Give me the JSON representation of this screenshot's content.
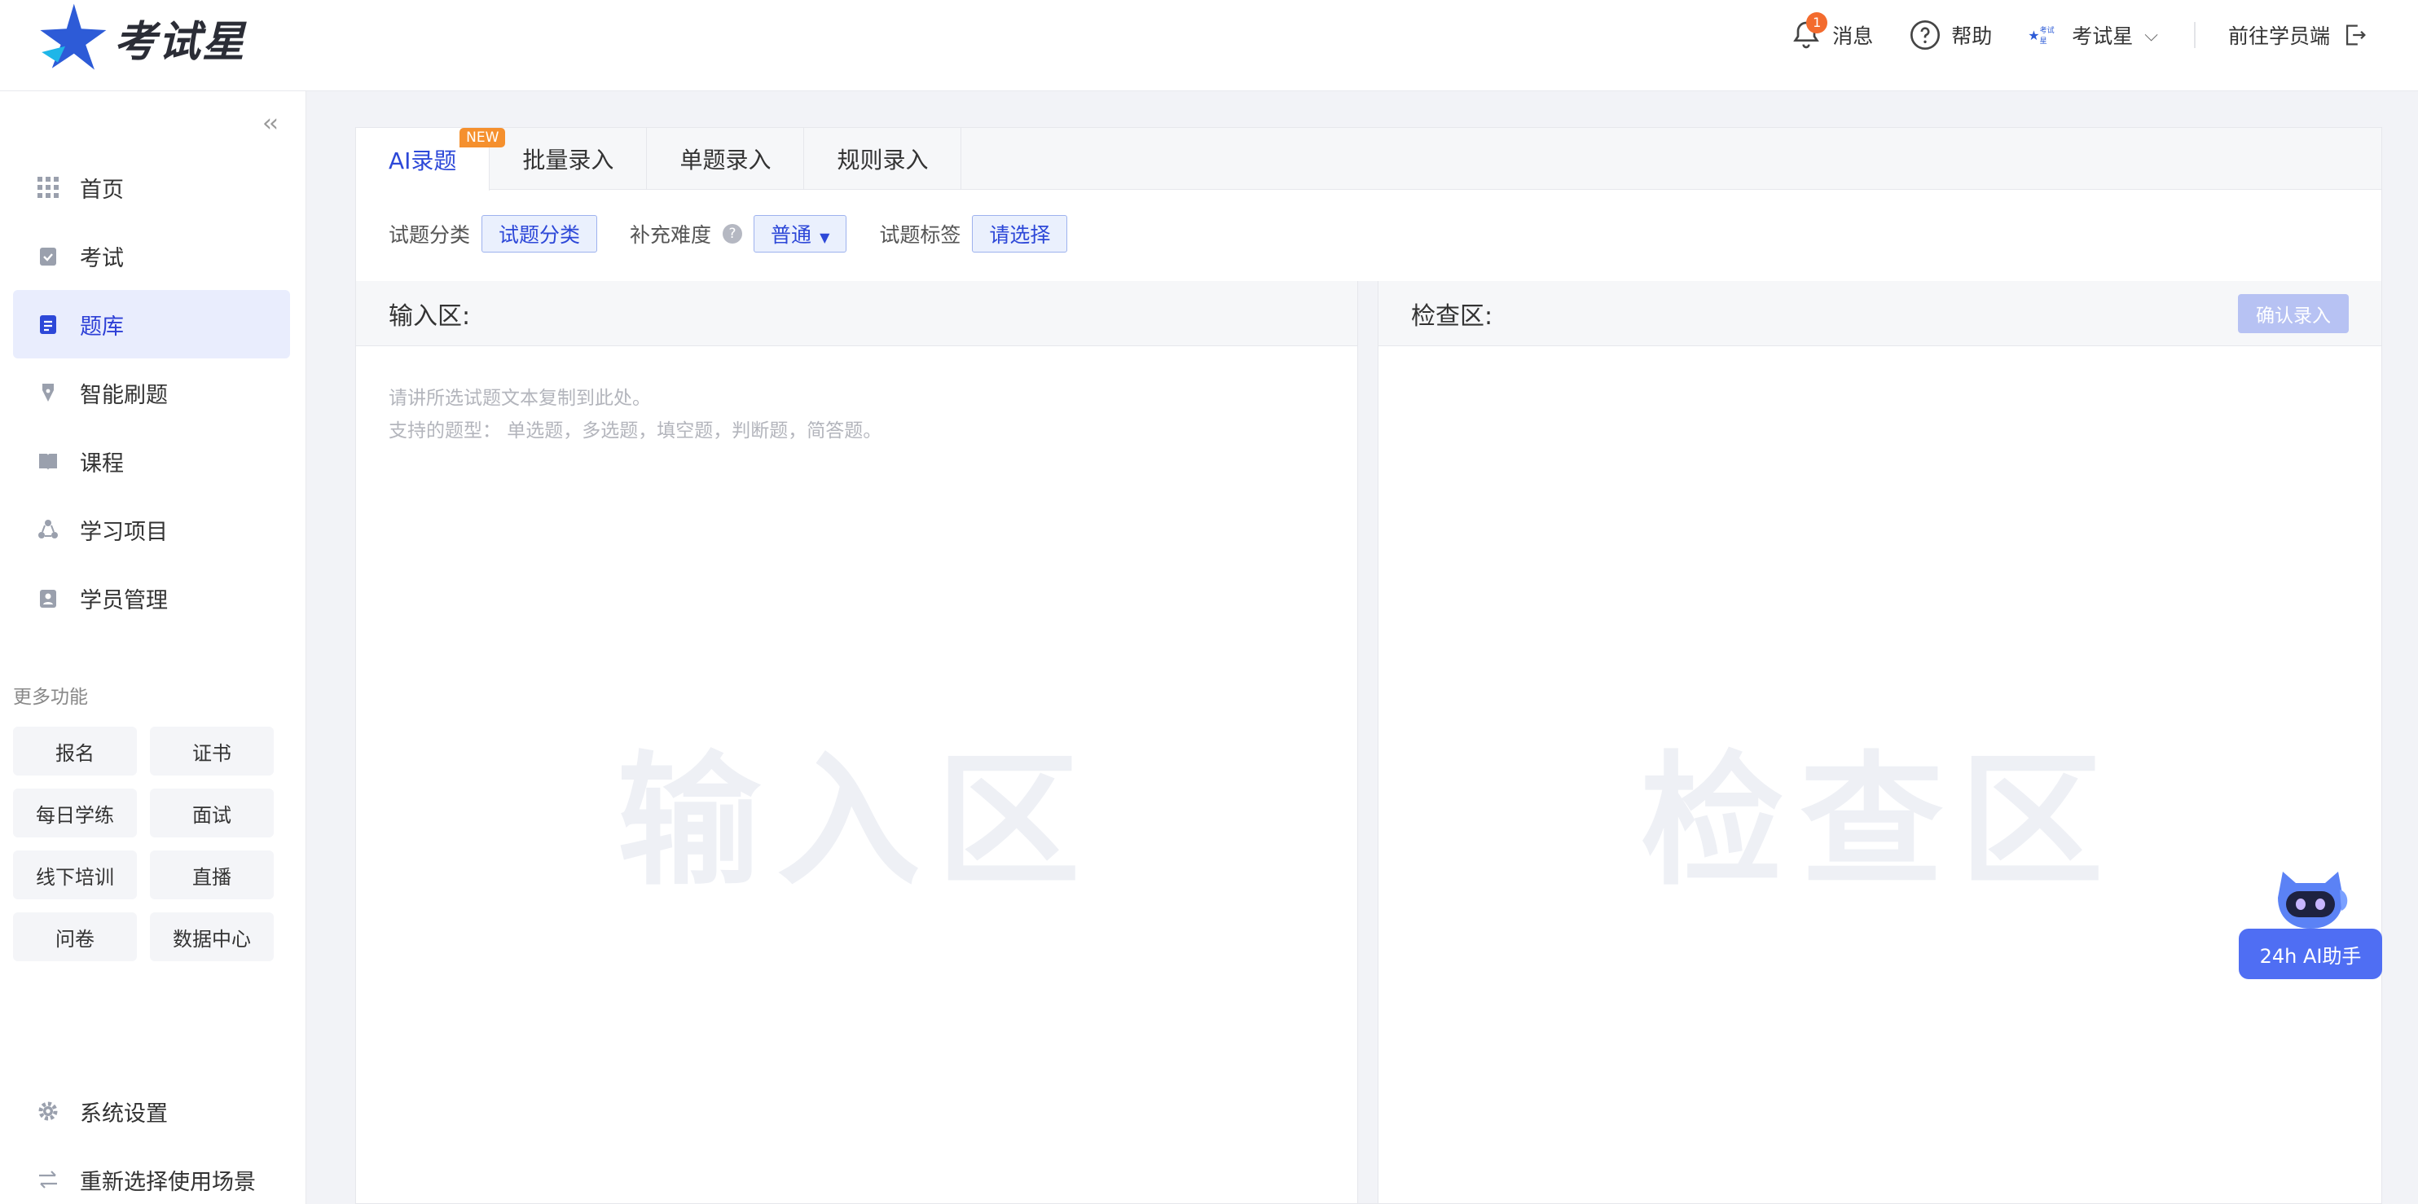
{
  "app": {
    "logo_text": "考试星",
    "brand_color": "#2d48d8"
  },
  "topbar": {
    "messages_label": "消息",
    "messages_count": "1",
    "help_label": "帮助",
    "org_name": "考试星",
    "org_logo_text": "考试星",
    "student_portal_label": "前往学员端"
  },
  "sidebar": {
    "items": [
      {
        "label": "首页",
        "icon": "grid-icon"
      },
      {
        "label": "考试",
        "icon": "clipboard-check-icon"
      },
      {
        "label": "题库",
        "icon": "document-list-icon",
        "active": true
      },
      {
        "label": "智能刷题",
        "icon": "pen-icon"
      },
      {
        "label": "课程",
        "icon": "book-icon"
      },
      {
        "label": "学习项目",
        "icon": "cycle-icon"
      },
      {
        "label": "学员管理",
        "icon": "id-card-icon"
      }
    ],
    "more_label": "更多功能",
    "more_items": [
      "报名",
      "证书",
      "每日学练",
      "面试",
      "线下培训",
      "直播",
      "问卷",
      "数据中心"
    ],
    "bottom_items": [
      {
        "label": "系统设置",
        "icon": "gear-icon"
      },
      {
        "label": "重新选择使用场景",
        "icon": "swap-icon"
      }
    ]
  },
  "tabs": [
    {
      "label": "AI录题",
      "active": true,
      "badge": "NEW"
    },
    {
      "label": "批量录入"
    },
    {
      "label": "单题录入"
    },
    {
      "label": "规则录入"
    }
  ],
  "filters": {
    "category_label": "试题分类",
    "category_value": "试题分类",
    "difficulty_label": "补充难度",
    "difficulty_value": "普通",
    "tags_label": "试题标签",
    "tags_value": "请选择"
  },
  "input_zone": {
    "title": "输入区:",
    "placeholder_line1": "请讲所选试题文本复制到此处。",
    "placeholder_line2": "支持的题型： 单选题，多选题，填空题，判断题，简答题。",
    "watermark": "输入区"
  },
  "check_zone": {
    "title": "检查区:",
    "confirm_label": "确认录入",
    "watermark": "检查区"
  },
  "ai_assistant": {
    "label": "24h AI助手"
  }
}
